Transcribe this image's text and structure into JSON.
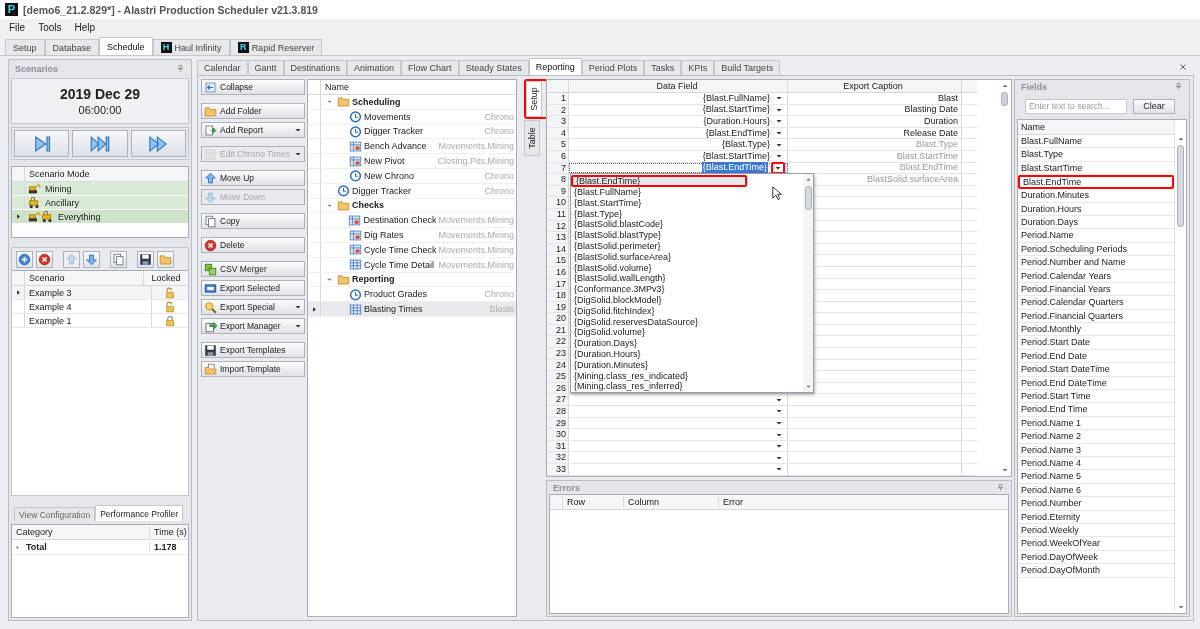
{
  "window": {
    "logo": "P",
    "title": "[demo6_21.2.829*] - Alastri Production Scheduler v21.3.819"
  },
  "menu": [
    "File",
    "Tools",
    "Help"
  ],
  "main_tabs": [
    {
      "label": "Setup",
      "selected": false
    },
    {
      "label": "Database",
      "selected": false
    },
    {
      "label": "Schedule",
      "selected": true
    },
    {
      "label": "Haul Infinity",
      "badge": "H",
      "selected": false
    },
    {
      "label": "Rapid Reserver",
      "badge": "R",
      "selected": false
    }
  ],
  "scenarios_panel": {
    "title": "Scenarios",
    "date": "2019 Dec 29",
    "time": "06:00:00",
    "playback_buttons": [
      {
        "kind": "step"
      },
      {
        "kind": "skip"
      },
      {
        "kind": "fast"
      }
    ],
    "mode_header": "Scenario Mode",
    "modes": [
      {
        "label": "Mining",
        "kind": "mining",
        "selected": false
      },
      {
        "label": "Ancillary",
        "kind": "ancillary",
        "selected": false
      },
      {
        "label": "Everything",
        "kind": "everything",
        "selected": true
      }
    ],
    "toolbar": [
      {
        "kind": "add",
        "disabled": false
      },
      {
        "kind": "remove",
        "disabled": false
      },
      {
        "kind": "up",
        "disabled": true
      },
      {
        "kind": "down",
        "disabled": false
      },
      {
        "kind": "copy",
        "disabled": false
      },
      {
        "kind": "save",
        "disabled": false
      },
      {
        "kind": "open",
        "disabled": false
      }
    ],
    "columns": [
      "Scenario",
      "Locked"
    ],
    "rows": [
      {
        "name": "Example 3",
        "locked": false,
        "selected": true
      },
      {
        "name": "Example 4",
        "locked": false,
        "selected": false
      },
      {
        "name": "Example 1",
        "locked": true,
        "selected": false
      }
    ]
  },
  "bottom_tabs": [
    {
      "label": "View Configuration",
      "selected": false
    },
    {
      "label": "Performance Profiler",
      "selected": true
    }
  ],
  "profiler": {
    "columns": [
      "Category",
      "Time (s)"
    ],
    "rows": [
      {
        "category": "Total",
        "time": "1.178",
        "expanded": false
      }
    ]
  },
  "sub_tabs": [
    {
      "label": "Calendar",
      "selected": false
    },
    {
      "label": "Gantt",
      "selected": false
    },
    {
      "label": "Destinations",
      "selected": false
    },
    {
      "label": "Animation",
      "selected": false
    },
    {
      "label": "Flow Chart",
      "selected": false
    },
    {
      "label": "Steady States",
      "selected": false
    },
    {
      "label": "Reporting",
      "selected": true
    },
    {
      "label": "Period Plots",
      "selected": false
    },
    {
      "label": "Tasks",
      "selected": false
    },
    {
      "label": "KPIs",
      "selected": false
    },
    {
      "label": "Build Targets",
      "selected": false
    }
  ],
  "action_groups": [
    [
      {
        "label": "Collapse",
        "kind": "collapse",
        "dropdown": false,
        "disabled": false
      }
    ],
    [
      {
        "label": "Add Folder",
        "kind": "folder",
        "dropdown": false,
        "disabled": false
      },
      {
        "label": "Add Report",
        "kind": "addreport",
        "dropdown": true,
        "disabled": false
      }
    ],
    [
      {
        "label": "Edit Chrono Times",
        "kind": "calendar",
        "dropdown": true,
        "disabled": true
      }
    ],
    [
      {
        "label": "Move Up",
        "kind": "up",
        "dropdown": false,
        "disabled": false
      },
      {
        "label": "Move Down",
        "kind": "down",
        "dropdown": false,
        "disabled": true
      }
    ],
    [
      {
        "label": "Copy",
        "kind": "copy",
        "dropdown": false,
        "disabled": false
      }
    ],
    [
      {
        "label": "Delete",
        "kind": "delete",
        "dropdown": false,
        "disabled": false
      }
    ],
    [
      {
        "label": "CSV Merger",
        "kind": "merge",
        "dropdown": false,
        "disabled": false
      },
      {
        "label": "Export Selected",
        "kind": "exportsel",
        "dropdown": false,
        "disabled": false
      },
      {
        "label": "Export Special",
        "kind": "special",
        "dropdown": true,
        "disabled": false
      },
      {
        "label": "Export Manager",
        "kind": "manager",
        "dropdown": true,
        "disabled": false
      }
    ],
    [
      {
        "label": "Export Templates",
        "kind": "save",
        "dropdown": false,
        "disabled": false
      },
      {
        "label": "Import Template",
        "kind": "import",
        "dropdown": false,
        "disabled": false
      }
    ]
  ],
  "report_tree": {
    "header": "Name",
    "items": [
      {
        "label": "Scheduling",
        "kind": "folder",
        "expanded": true,
        "selected": false,
        "children": [
          {
            "label": "Movements",
            "kind": "chrono",
            "type": "Chrono",
            "selected": false
          },
          {
            "label": "Digger Tracker",
            "kind": "chrono",
            "type": "Chrono",
            "selected": false
          },
          {
            "label": "Bench Advance",
            "kind": "pivot",
            "type": "Movements.Mining",
            "selected": false
          },
          {
            "label": "New Pivot",
            "kind": "pivot",
            "type": "Closing.Pits.Mining",
            "selected": false
          },
          {
            "label": "New Chrono",
            "kind": "chrono",
            "type": "Chrono",
            "selected": false
          }
        ]
      },
      {
        "label": "Digger Tracker",
        "kind": "chrono",
        "type": "Chrono",
        "selected": false
      },
      {
        "label": "Checks",
        "kind": "folder",
        "expanded": true,
        "selected": false,
        "children": [
          {
            "label": "Destination Check",
            "kind": "pivot",
            "type": "Movements.Mining",
            "selected": false
          },
          {
            "label": "Dig Rates",
            "kind": "pivot",
            "type": "Movements.Mining",
            "selected": false
          },
          {
            "label": "Cycle Time Check",
            "kind": "pivot",
            "type": "Movements.Mining",
            "selected": false
          },
          {
            "label": "Cycle Time Detail",
            "kind": "table",
            "type": "Movements.Mining",
            "selected": false
          }
        ]
      },
      {
        "label": "Reporting",
        "kind": "folder",
        "expanded": true,
        "selected": false,
        "children": [
          {
            "label": "Product Grades",
            "kind": "chrono",
            "type": "Chrono",
            "selected": false
          },
          {
            "label": "Blasting Times",
            "kind": "table",
            "type": "Blasts",
            "selected": true
          }
        ]
      }
    ]
  },
  "side_tabs": [
    {
      "label": "Setup",
      "selected": true,
      "annotated": true
    },
    {
      "label": "Table",
      "selected": false,
      "annotated": false
    }
  ],
  "export_grid": {
    "columns": [
      "Data Field",
      "Export Caption"
    ],
    "rows": [
      {
        "n": "1",
        "field": "{Blast.FullName}",
        "caption": "Blast",
        "default_caption": false,
        "editing": false,
        "arrow": true,
        "arrow_annotated": false
      },
      {
        "n": "2",
        "field": "{Blast.StartTime}",
        "caption": "Blasting Date",
        "default_caption": false,
        "editing": false,
        "arrow": true,
        "arrow_annotated": false
      },
      {
        "n": "3",
        "field": "{Duration.Hours}",
        "caption": "Duration",
        "default_caption": false,
        "editing": false,
        "arrow": true,
        "arrow_annotated": false
      },
      {
        "n": "4",
        "field": "{Blast.EndTime}",
        "caption": "Release Date",
        "default_caption": false,
        "editing": false,
        "arrow": true,
        "arrow_annotated": false
      },
      {
        "n": "5",
        "field": "{Blast.Type}",
        "caption": "Blast.Type",
        "default_caption": true,
        "editing": false,
        "arrow": true,
        "arrow_annotated": false
      },
      {
        "n": "6",
        "field": "{Blast.StartTime}",
        "caption": "Blast.StartTime",
        "default_caption": true,
        "editing": false,
        "arrow": true,
        "arrow_annotated": false
      },
      {
        "n": "7",
        "field": "{Blast.EndTime}",
        "caption": "Blast.EndTime",
        "default_caption": true,
        "editing": true,
        "arrow": true,
        "arrow_annotated": true
      },
      {
        "n": "8",
        "caption": "BlastSolid.surfaceArea",
        "default_caption": true
      },
      {
        "n": "9"
      },
      {
        "n": "10"
      },
      {
        "n": "11"
      },
      {
        "n": "12"
      },
      {
        "n": "13"
      },
      {
        "n": "14"
      },
      {
        "n": "15"
      },
      {
        "n": "16"
      },
      {
        "n": "17"
      },
      {
        "n": "18"
      },
      {
        "n": "19"
      },
      {
        "n": "20"
      },
      {
        "n": "21"
      },
      {
        "n": "22"
      },
      {
        "n": "23"
      },
      {
        "n": "24"
      },
      {
        "n": "25"
      },
      {
        "n": "26"
      },
      {
        "n": "27",
        "editing": false,
        "arrow": true,
        "arrow_annotated": false
      },
      {
        "n": "28",
        "editing": false,
        "arrow": true,
        "arrow_annotated": false
      },
      {
        "n": "29",
        "editing": false,
        "arrow": true,
        "arrow_annotated": false
      },
      {
        "n": "30",
        "editing": false,
        "arrow": true,
        "arrow_annotated": false
      },
      {
        "n": "31",
        "editing": false,
        "arrow": true,
        "arrow_annotated": false
      },
      {
        "n": "32",
        "editing": false,
        "arrow": true,
        "arrow_annotated": false
      },
      {
        "n": "33",
        "editing": false,
        "arrow": true,
        "arrow_annotated": false
      }
    ],
    "dropdown": [
      {
        "label": "{Blast.EndTime}",
        "selected": true,
        "annotated": true
      },
      {
        "label": "{Blast.FullName}",
        "selected": false,
        "annotated": false
      },
      {
        "label": "{Blast.StartTime}",
        "selected": false,
        "annotated": false
      },
      {
        "label": "{Blast.Type}",
        "selected": false,
        "annotated": false
      },
      {
        "label": "{BlastSolid.blastCode}",
        "selected": false,
        "annotated": false
      },
      {
        "label": "{BlastSolid.blastType}",
        "selected": false,
        "annotated": false
      },
      {
        "label": "{BlastSolid.perimeter}",
        "selected": false,
        "annotated": false
      },
      {
        "label": "{BlastSolid.surfaceArea}",
        "selected": false,
        "annotated": false
      },
      {
        "label": "{BlastSolid.volume}",
        "selected": false,
        "annotated": false
      },
      {
        "label": "{BlastSolid.wallLength}",
        "selected": false,
        "annotated": false
      },
      {
        "label": "{Conformance.3MPv3}",
        "selected": false,
        "annotated": false
      },
      {
        "label": "{DigSolid.blockModel}",
        "selected": false,
        "annotated": false
      },
      {
        "label": "{DigSolid.fitchIndex}",
        "selected": false,
        "annotated": false
      },
      {
        "label": "{DigSolid.reservesDataSource}",
        "selected": false,
        "annotated": false
      },
      {
        "label": "{DigSolid.volume}",
        "selected": false,
        "annotated": false
      },
      {
        "label": "{Duration.Days}",
        "selected": false,
        "annotated": false
      },
      {
        "label": "{Duration.Hours}",
        "selected": false,
        "annotated": false
      },
      {
        "label": "{Duration.Minutes}",
        "selected": false,
        "annotated": false
      },
      {
        "label": "{Mining.class_res_indicated}",
        "selected": false,
        "annotated": false
      },
      {
        "label": "{Mining.class_res_inferred}",
        "selected": false,
        "annotated": false
      }
    ]
  },
  "errors_panel": {
    "title": "Errors",
    "columns": [
      "Row",
      "Column",
      "Error"
    ]
  },
  "fields_panel": {
    "title": "Fields",
    "search": {
      "placeholder": "Enter text to search..."
    },
    "clear_button": "Clear",
    "header": "Name",
    "items": [
      {
        "label": "Blast.FullName",
        "annotated": false
      },
      {
        "label": "Blast.Type",
        "annotated": false
      },
      {
        "label": "Blast.StartTime",
        "annotated": false
      },
      {
        "label": "Blast.EndTime",
        "annotated": true
      },
      {
        "label": "Duration.Minutes",
        "annotated": false
      },
      {
        "label": "Duration.Hours",
        "annotated": false
      },
      {
        "label": "Duration.Days",
        "annotated": false
      },
      {
        "label": "Period.Name",
        "annotated": false
      },
      {
        "label": "Period.Scheduling Periods",
        "annotated": false
      },
      {
        "label": "Period.Number and Name",
        "annotated": false
      },
      {
        "label": "Period.Calendar Years",
        "annotated": false
      },
      {
        "label": "Period.Financial Years",
        "annotated": false
      },
      {
        "label": "Period.Calendar Quarters",
        "annotated": false
      },
      {
        "label": "Period.Financial Quarters",
        "annotated": false
      },
      {
        "label": "Period.Monthly",
        "annotated": false
      },
      {
        "label": "Period.Start Date",
        "annotated": false
      },
      {
        "label": "Period.End Date",
        "annotated": false
      },
      {
        "label": "Period.Start DateTime",
        "annotated": false
      },
      {
        "label": "Period.End DateTime",
        "annotated": false
      },
      {
        "label": "Period.Start Time",
        "annotated": false
      },
      {
        "label": "Period.End Time",
        "annotated": false
      },
      {
        "label": "Period.Name 1",
        "annotated": false
      },
      {
        "label": "Period.Name 2",
        "annotated": false
      },
      {
        "label": "Period.Name 3",
        "annotated": false
      },
      {
        "label": "Period.Name 4",
        "annotated": false
      },
      {
        "label": "Period.Name 5",
        "annotated": false
      },
      {
        "label": "Period.Name 6",
        "annotated": false
      },
      {
        "label": "Period.Number",
        "annotated": false
      },
      {
        "label": "Period.Eternity",
        "annotated": false
      },
      {
        "label": "Period.Weekly",
        "annotated": false
      },
      {
        "label": "Period.WeekOfYear",
        "annotated": false
      },
      {
        "label": "Period.DayOfWeek",
        "annotated": false
      },
      {
        "label": "Period.DayOfMonth",
        "annotated": false
      }
    ]
  }
}
